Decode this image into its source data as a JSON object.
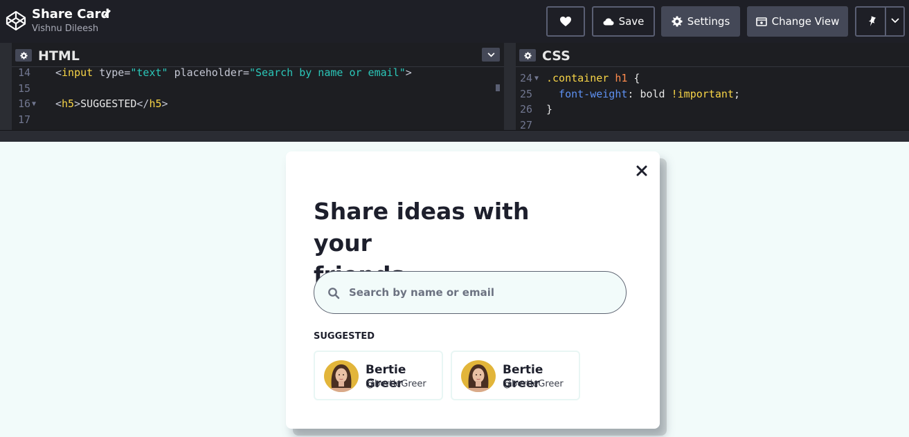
{
  "header": {
    "title": "Share Card",
    "author": "Vishnu Dileesh",
    "buttons": {
      "save": "Save",
      "settings": "Settings",
      "change_view": "Change View"
    }
  },
  "editors": {
    "html": {
      "label": "HTML",
      "lines": [
        {
          "num": "14",
          "tokens": [
            {
              "t": "<",
              "c": "t-punc"
            },
            {
              "t": "input",
              "c": "t-tag"
            },
            {
              "t": " type",
              "c": "t-attr"
            },
            {
              "t": "=",
              "c": "t-punc"
            },
            {
              "t": "\"text\"",
              "c": "t-str"
            },
            {
              "t": " placeholder",
              "c": "t-attr"
            },
            {
              "t": "=",
              "c": "t-punc"
            },
            {
              "t": "\"Search by name or email\"",
              "c": "t-str"
            },
            {
              "t": ">",
              "c": "t-punc"
            }
          ]
        },
        {
          "num": "15",
          "tokens": []
        },
        {
          "num": "16",
          "fold": true,
          "tokens": [
            {
              "t": "<",
              "c": "t-punc"
            },
            {
              "t": "h5",
              "c": "t-tag"
            },
            {
              "t": ">",
              "c": "t-punc"
            },
            {
              "t": "SUGGESTED",
              "c": "t-txt"
            },
            {
              "t": "</",
              "c": "t-punc"
            },
            {
              "t": "h5",
              "c": "t-tag"
            },
            {
              "t": ">",
              "c": "t-punc"
            }
          ]
        },
        {
          "num": "17",
          "tokens": []
        }
      ]
    },
    "css": {
      "label": "CSS",
      "lines": [
        {
          "num": "24",
          "fold": true,
          "tokens": [
            {
              "t": ".container",
              "c": "t-sel"
            },
            {
              "t": " h1",
              "c": "t-el"
            },
            {
              "t": " {",
              "c": "t-val"
            }
          ]
        },
        {
          "num": "25",
          "tokens": [
            {
              "t": "  font-weight",
              "c": "t-prop"
            },
            {
              "t": ": ",
              "c": "t-val"
            },
            {
              "t": "bold",
              "c": "t-val"
            },
            {
              "t": " !important",
              "c": "t-imp"
            },
            {
              "t": ";",
              "c": "t-val"
            }
          ]
        },
        {
          "num": "26",
          "tokens": [
            {
              "t": "}",
              "c": "t-val"
            }
          ]
        },
        {
          "num": "27",
          "tokens": []
        }
      ]
    }
  },
  "card": {
    "heading_line1": "Share ideas with your",
    "heading_line2": "friends",
    "search_placeholder": "Search by name or email",
    "suggested_label": "SUGGESTED",
    "users": [
      {
        "name": "Bertie Greer",
        "handle": "@bertieGreer"
      },
      {
        "name": "Bertie Greer",
        "handle": "@bertieGreer"
      }
    ]
  }
}
